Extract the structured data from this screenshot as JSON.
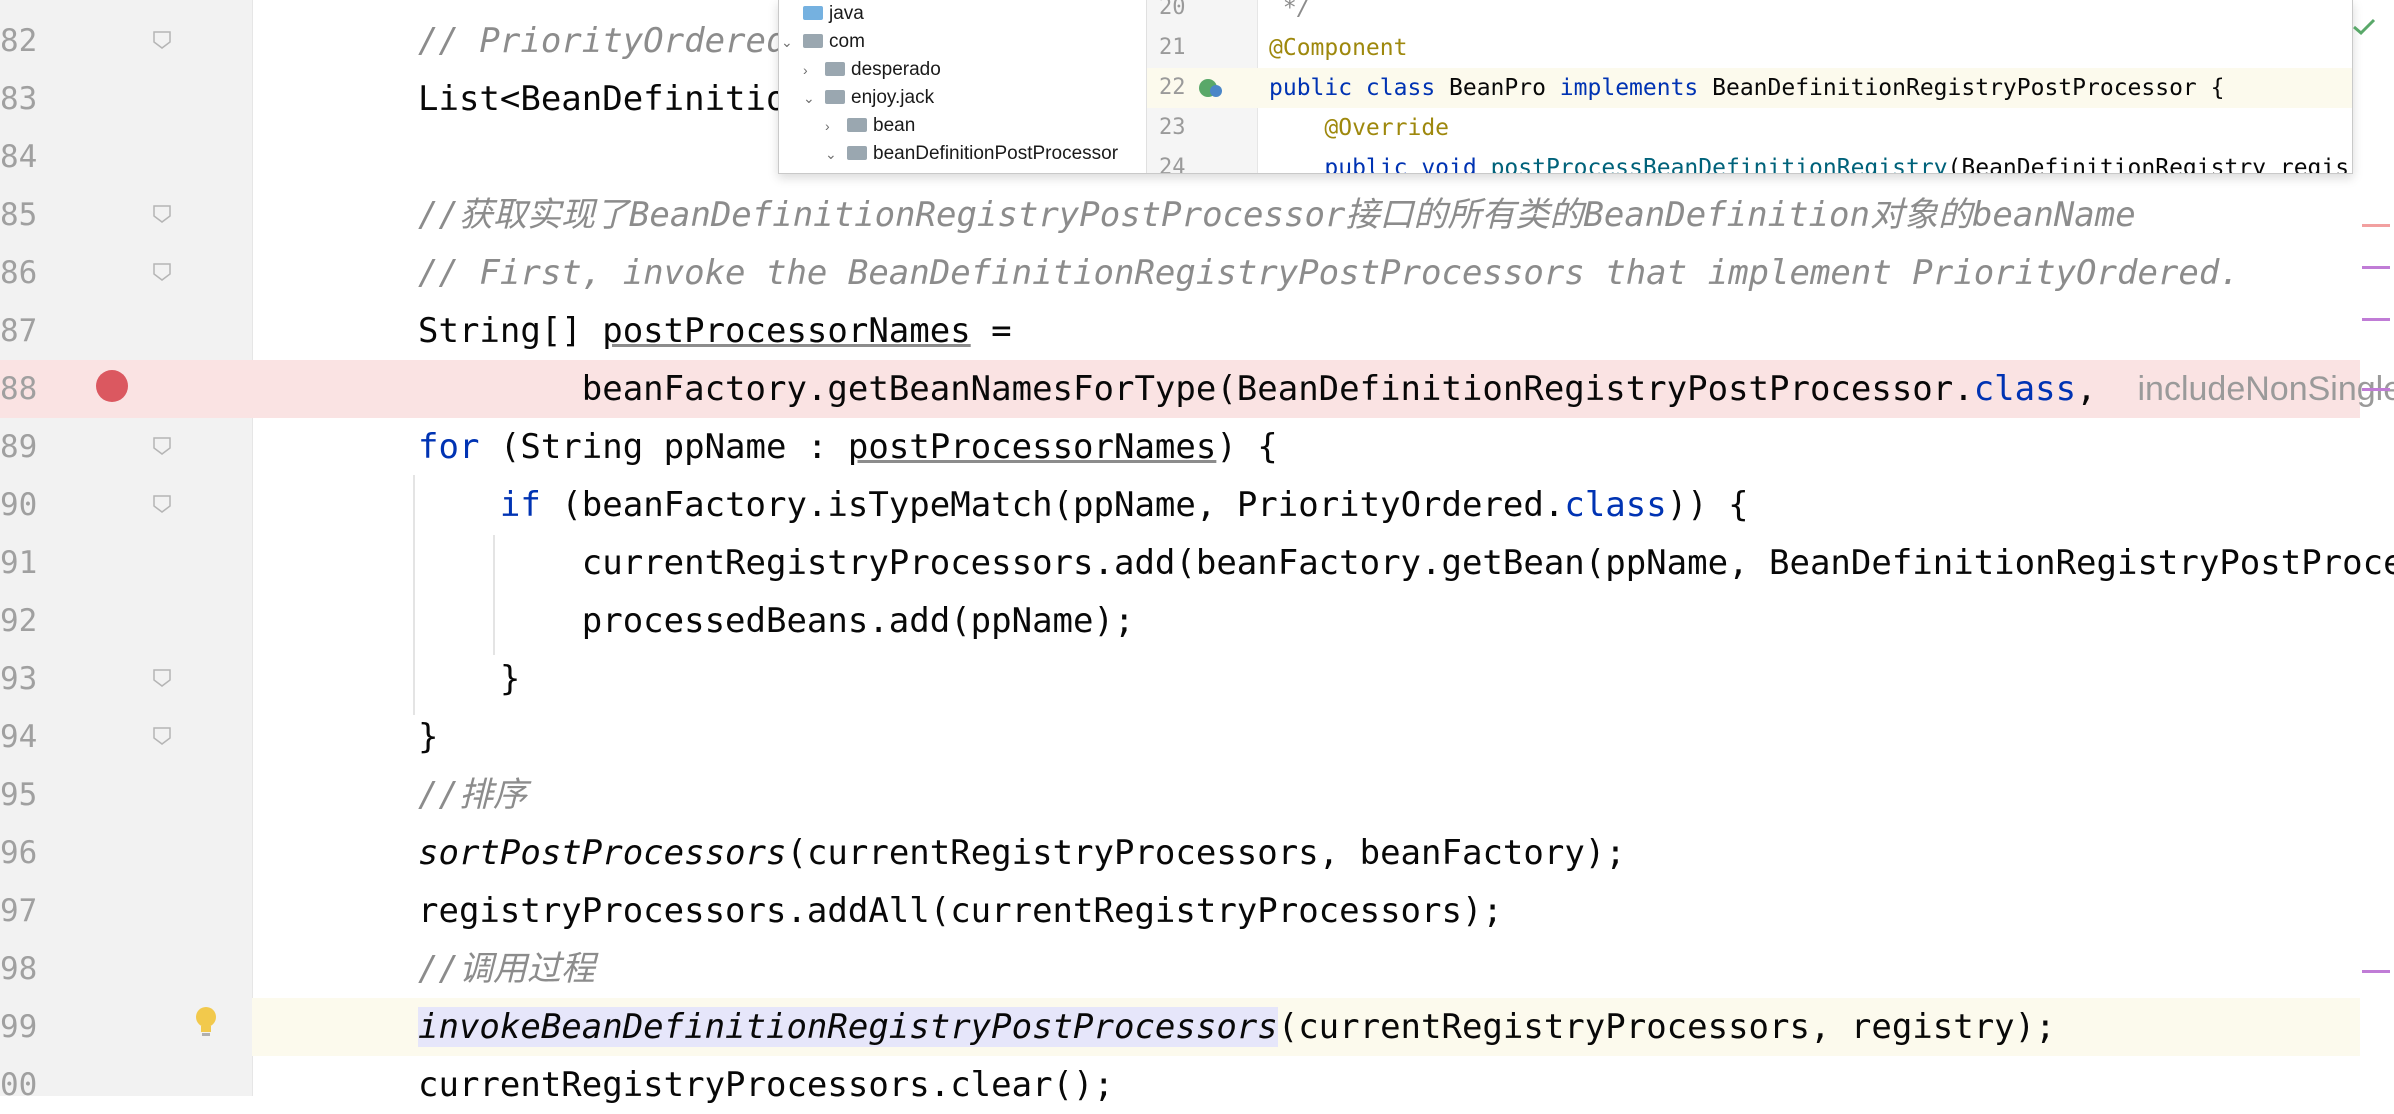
{
  "editor": {
    "lines": [
      {
        "num": "82",
        "segments": [
          {
            "t": "// PriorityOrdered",
            "c": "cmt"
          }
        ]
      },
      {
        "num": "83",
        "segments": [
          {
            "t": "List<BeanDefinitio",
            "c": ""
          }
        ]
      },
      {
        "num": "84",
        "segments": []
      },
      {
        "num": "85",
        "segments": [
          {
            "t": "//获取实现了BeanDefinitionRegistryPostProcessor接口的所有类的BeanDefinition对象的beanName",
            "c": "cmt"
          }
        ]
      },
      {
        "num": "86",
        "segments": [
          {
            "t": "// First, invoke the BeanDefinitionRegistryPostProcessors that implement PriorityOrdered.",
            "c": "cmt"
          }
        ]
      },
      {
        "num": "87",
        "segments": [
          {
            "t": "String[] ",
            "c": ""
          },
          {
            "t": "postProcessorNames",
            "c": "ul"
          },
          {
            "t": " =",
            "c": ""
          }
        ]
      },
      {
        "num": "88",
        "segments": [
          {
            "t": "        beanFactory.getBeanNamesForType(BeanDefinitionRegistryPostProcessor.",
            "c": ""
          },
          {
            "t": "class",
            "c": "kw"
          },
          {
            "t": ",  ",
            "c": ""
          },
          {
            "t": "includeNonSingleto",
            "c": "hint"
          }
        ]
      },
      {
        "num": "89",
        "segments": [
          {
            "t": "for",
            "c": "kw"
          },
          {
            "t": " (String ppName : ",
            "c": ""
          },
          {
            "t": "postProcessorNames",
            "c": "ul"
          },
          {
            "t": ") {",
            "c": ""
          }
        ]
      },
      {
        "num": "90",
        "segments": [
          {
            "t": "    ",
            "c": ""
          },
          {
            "t": "if",
            "c": "kw"
          },
          {
            "t": " (beanFactory.isTypeMatch(ppName, PriorityOrdered.",
            "c": ""
          },
          {
            "t": "class",
            "c": "kw"
          },
          {
            "t": ")) {",
            "c": ""
          }
        ]
      },
      {
        "num": "91",
        "segments": [
          {
            "t": "        currentRegistryProcessors.add(beanFactory.getBean(ppName, BeanDefinitionRegistryPostProcess",
            "c": ""
          }
        ]
      },
      {
        "num": "92",
        "segments": [
          {
            "t": "        processedBeans.add(ppName);",
            "c": ""
          }
        ]
      },
      {
        "num": "93",
        "segments": [
          {
            "t": "    }",
            "c": ""
          }
        ]
      },
      {
        "num": "94",
        "segments": [
          {
            "t": "}",
            "c": ""
          }
        ]
      },
      {
        "num": "95",
        "segments": [
          {
            "t": "//排序",
            "c": "cmt"
          }
        ]
      },
      {
        "num": "96",
        "segments": [
          {
            "t": "sortPostProcessors",
            "c": "ital"
          },
          {
            "t": "(currentRegistryProcessors, beanFactory);",
            "c": ""
          }
        ]
      },
      {
        "num": "97",
        "segments": [
          {
            "t": "registryProcessors.addAll(currentRegistryProcessors);",
            "c": ""
          }
        ]
      },
      {
        "num": "98",
        "segments": [
          {
            "t": "//调用过程",
            "c": "cmt"
          }
        ]
      },
      {
        "num": "99",
        "segments": [
          {
            "t": "invokeBeanDefinitionRegistryPostProcessors",
            "c": "ital hl-sel"
          },
          {
            "t": "(currentRegistryProcessors, registry);",
            "c": ""
          }
        ]
      },
      {
        "num": "00",
        "segments": [
          {
            "t": "currentRegistryProcessors.clear();",
            "c": ""
          }
        ]
      }
    ],
    "breakpoint_line": "88",
    "current_line": "99"
  },
  "popup": {
    "tree": [
      {
        "label": "java",
        "chevron": "",
        "folder": "blue"
      },
      {
        "label": "com",
        "chevron": "⌄",
        "folder": "grey"
      },
      {
        "label": "desperado",
        "chevron": "›",
        "folder": "grey"
      },
      {
        "label": "enjoy.jack",
        "chevron": "⌄",
        "folder": "grey"
      },
      {
        "label": "bean",
        "chevron": "›",
        "folder": "grey"
      },
      {
        "label": "beanDefinitionPostProcessor",
        "chevron": "⌄",
        "folder": "grey"
      }
    ],
    "preview": [
      {
        "num": "20",
        "segments": [
          {
            "t": " */",
            "c": "cmt"
          }
        ]
      },
      {
        "num": "21",
        "segments": [
          {
            "t": "@Component",
            "c": "ann"
          }
        ]
      },
      {
        "num": "22",
        "segments": [
          {
            "t": "public class ",
            "c": "kw"
          },
          {
            "t": "BeanPro",
            "c": ""
          },
          {
            "t": " implements ",
            "c": "kw"
          },
          {
            "t": "BeanDefinitionRegistryPostProcessor {",
            "c": ""
          }
        ]
      },
      {
        "num": "23",
        "segments": [
          {
            "t": "    @Override",
            "c": "ann"
          }
        ]
      },
      {
        "num": "24",
        "segments": [
          {
            "t": "    public void ",
            "c": "kw"
          },
          {
            "t": "postProcessBeanDefinitionRegistry",
            "c": "fn ul"
          },
          {
            "t": "(BeanDefinitionRegistry regis",
            "c": ""
          }
        ]
      }
    ]
  },
  "colors": {
    "breakpoint": "#db5860",
    "keyword": "#0033b3",
    "comment": "#8c8c8c",
    "annotation": "#9e880d",
    "breakpoint_line_bg": "#fae3e3",
    "current_line_bg": "#fcfaed"
  },
  "icons": [
    "breakpoint-icon",
    "bulb-icon",
    "fold-icon",
    "folder-icon",
    "chevron-icon",
    "checkmark-icon",
    "bean-gutter-icon"
  ]
}
